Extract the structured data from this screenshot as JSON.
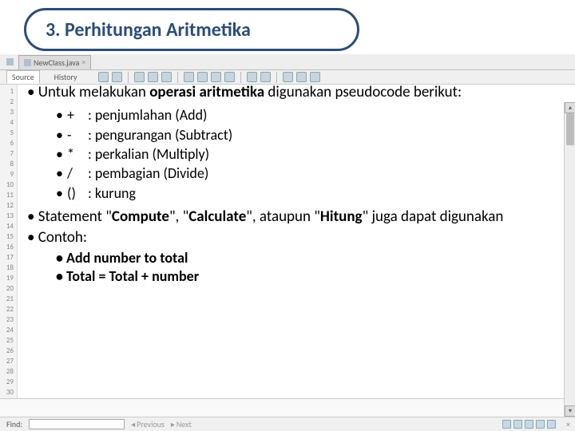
{
  "title": "3. Perhitungan Aritmetika",
  "tab": {
    "label": "NewClass.java"
  },
  "subtabs": {
    "source": "Source",
    "history": "History"
  },
  "intro": {
    "pre": "Untuk melakukan ",
    "bold": "operasi aritmetika",
    "post": " digunakan pseudocode berikut:"
  },
  "ops": [
    {
      "sym": "+",
      "desc": ": penjumlahan (Add)"
    },
    {
      "sym": "-",
      "desc": ": pengurangan (Subtract)"
    },
    {
      "sym": "*",
      "desc": ": perkalian (Multiply)"
    },
    {
      "sym": "/",
      "desc": ": pembagian (Divide)"
    },
    {
      "sym": "()",
      "desc": ": kurung"
    }
  ],
  "stmt": {
    "pre": "Statement \"",
    "w1": "Compute",
    "mid1": "\", \"",
    "w2": "Calculate",
    "mid2": "\", ataupun \"",
    "w3": "Hitung",
    "post": "\" juga dapat digunakan"
  },
  "contoh": "Contoh:",
  "examples": {
    "e1": "Add number to total",
    "e2": "Total = Total + number"
  },
  "findbar": {
    "label": "Find:",
    "prev": "Previous",
    "next": "Next"
  },
  "line_numbers": [
    "1",
    "2",
    "3",
    "4",
    "5",
    "6",
    "7",
    "8",
    "9",
    "10",
    "11",
    "12",
    "13",
    "14",
    "15",
    "16",
    "17",
    "18",
    "19",
    "20",
    "21",
    "22",
    "23",
    "24",
    "25",
    "26",
    "27",
    "28",
    "29",
    "30"
  ]
}
